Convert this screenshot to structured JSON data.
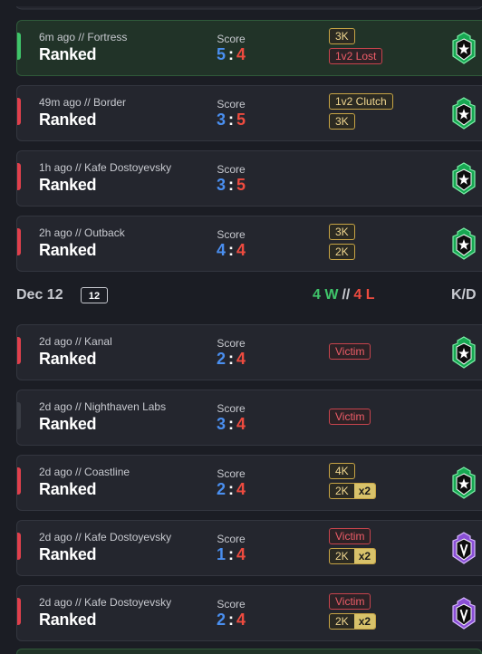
{
  "day_sections": [
    {
      "matches": [
        {
          "time_map": "6m ago // Fortress",
          "mode": "Ranked",
          "score_label": "Score",
          "score_left": "5",
          "score_right": "4",
          "result": "win",
          "rank": "emerald-rank-icon",
          "badges": [
            {
              "text": "3K",
              "style": "gold"
            },
            {
              "text": "1v2 Lost",
              "style": "red"
            }
          ]
        },
        {
          "time_map": "49m ago // Border",
          "mode": "Ranked",
          "score_label": "Score",
          "score_left": "3",
          "score_right": "5",
          "result": "loss",
          "rank": "emerald-rank-icon",
          "badges": [
            {
              "text": "1v2 Clutch",
              "style": "gold"
            },
            {
              "text": "3K",
              "style": "gold"
            }
          ]
        },
        {
          "time_map": "1h ago // Kafe Dostoyevsky",
          "mode": "Ranked",
          "score_label": "Score",
          "score_left": "3",
          "score_right": "5",
          "result": "loss",
          "rank": "emerald-rank-icon",
          "badges": []
        },
        {
          "time_map": "2h ago // Outback",
          "mode": "Ranked",
          "score_label": "Score",
          "score_left": "4",
          "score_right": "4",
          "result": "loss",
          "rank": "emerald-rank-icon",
          "badges": [
            {
              "text": "3K",
              "style": "gold"
            },
            {
              "text": "2K",
              "style": "gold"
            }
          ]
        }
      ]
    },
    {
      "date": "Dec 12",
      "count": "12",
      "wins": "4 W",
      "separator": "//",
      "losses": "4 L",
      "kd_header": "K/D",
      "matches": [
        {
          "time_map": "2d ago // Kanal",
          "mode": "Ranked",
          "score_label": "Score",
          "score_left": "2",
          "score_right": "4",
          "result": "loss",
          "rank": "emerald-rank-icon",
          "badges": [
            {
              "text": "Victim",
              "style": "red"
            }
          ]
        },
        {
          "time_map": "2d ago // Nighthaven Labs",
          "mode": "Ranked",
          "score_label": "Score",
          "score_left": "3",
          "score_right": "4",
          "result": "neutral",
          "rank": "",
          "badges": [
            {
              "text": "Victim",
              "style": "red"
            }
          ]
        },
        {
          "time_map": "2d ago // Coastline",
          "mode": "Ranked",
          "score_label": "Score",
          "score_left": "2",
          "score_right": "4",
          "result": "loss",
          "rank": "emerald-rank-icon",
          "badges": [
            {
              "text": "4K",
              "style": "gold"
            },
            {
              "text": "2K",
              "style": "gold",
              "multiplier": "x2"
            }
          ]
        },
        {
          "time_map": "2d ago // Kafe Dostoyevsky",
          "mode": "Ranked",
          "score_label": "Score",
          "score_left": "1",
          "score_right": "4",
          "result": "loss",
          "rank": "amethyst-rank-icon",
          "badges": [
            {
              "text": "Victim",
              "style": "red"
            },
            {
              "text": "2K",
              "style": "gold",
              "multiplier": "x2"
            }
          ]
        },
        {
          "time_map": "2d ago // Kafe Dostoyevsky",
          "mode": "Ranked",
          "score_label": "Score",
          "score_left": "2",
          "score_right": "4",
          "result": "loss",
          "rank": "amethyst-rank-icon",
          "badges": [
            {
              "text": "Victim",
              "style": "red"
            },
            {
              "text": "2K",
              "style": "gold",
              "multiplier": "x2"
            }
          ]
        }
      ]
    }
  ],
  "colors": {
    "background": "#1b1d24",
    "card": "#24262e",
    "card_win": "#213328",
    "score_left": "#4a8ff0",
    "score_right": "#ee4b3f",
    "win": "#3fc46a",
    "loss": "#e0404c",
    "gold_badge": "#c7a445",
    "red_badge": "#c8444d"
  }
}
